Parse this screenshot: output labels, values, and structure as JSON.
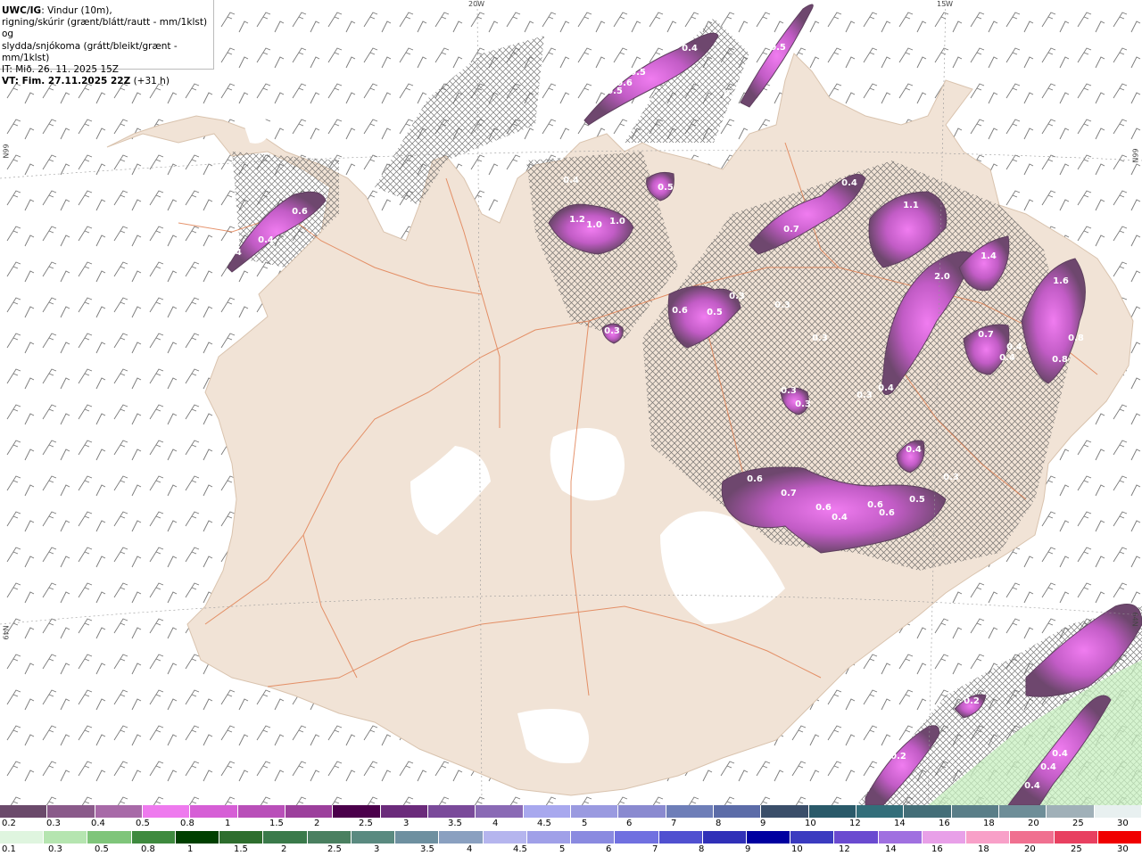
{
  "info": {
    "line1_bold": "UWC/IG",
    "line1_rest": ": Vindur (10m),",
    "line2": "rigning/skúrir (grænt/blátt/rautt - mm/1klst) og",
    "line3": "slydda/snjókoma (grátt/bleikt/grænt - mm/1klst)",
    "line4": "IT: Mið. 26. 11. 2025 15Z",
    "line5_bold": "VT: Fim. 27.11.2025 22Z",
    "line5_rest": " (+31 h)"
  },
  "grid_labels": {
    "lon_20w": "20W",
    "lon_15w": "15W",
    "lat_66n_left": "66N",
    "lat_66n_right": "66N",
    "lat_64n_left": "N49",
    "lat_64n_right": "64N"
  },
  "precip_labels": [
    {
      "id": "a1",
      "text": "0.4"
    },
    {
      "id": "a2",
      "text": "0.5"
    },
    {
      "id": "a3",
      "text": "0.5"
    },
    {
      "id": "a4",
      "text": "0.6"
    },
    {
      "id": "a5",
      "text": "0.5"
    },
    {
      "id": "a6",
      "text": "0.4"
    },
    {
      "id": "a7",
      "text": "0.5"
    },
    {
      "id": "a8",
      "text": "0.3"
    },
    {
      "id": "a9",
      "text": "0.6"
    },
    {
      "id": "a10",
      "text": "0.4"
    },
    {
      "id": "a11",
      "text": "0.4"
    },
    {
      "id": "a12",
      "text": "1.2"
    },
    {
      "id": "a13",
      "text": "1.0"
    },
    {
      "id": "a14",
      "text": "1.0"
    },
    {
      "id": "a15",
      "text": "0.5"
    },
    {
      "id": "a16",
      "text": "0.4"
    },
    {
      "id": "a17",
      "text": "1.1"
    },
    {
      "id": "a18",
      "text": "0.7"
    },
    {
      "id": "a19",
      "text": "1.4"
    },
    {
      "id": "a20",
      "text": "2.0"
    },
    {
      "id": "a21",
      "text": "1.6"
    },
    {
      "id": "a22",
      "text": "0.6"
    },
    {
      "id": "a23",
      "text": "0.5"
    },
    {
      "id": "a24",
      "text": "0.3"
    },
    {
      "id": "a25",
      "text": "0.3"
    },
    {
      "id": "a26",
      "text": "0.3"
    },
    {
      "id": "a27",
      "text": "0.7"
    },
    {
      "id": "a28",
      "text": "0.4"
    },
    {
      "id": "a29",
      "text": "0.8"
    },
    {
      "id": "a30",
      "text": "0.8"
    },
    {
      "id": "a31",
      "text": "0.4"
    },
    {
      "id": "a32",
      "text": "0.3"
    },
    {
      "id": "a33",
      "text": "0.3"
    },
    {
      "id": "a34",
      "text": "0.3"
    },
    {
      "id": "a35",
      "text": "0.4"
    },
    {
      "id": "a36",
      "text": "0.3"
    },
    {
      "id": "a37",
      "text": "0.4"
    },
    {
      "id": "a38",
      "text": "0.6"
    },
    {
      "id": "a39",
      "text": "0.7"
    },
    {
      "id": "a40",
      "text": "0.6"
    },
    {
      "id": "a41",
      "text": "0.4"
    },
    {
      "id": "a42",
      "text": "0.6"
    },
    {
      "id": "a43",
      "text": "0.6"
    },
    {
      "id": "a44",
      "text": "0.5"
    },
    {
      "id": "a45",
      "text": "0.3"
    },
    {
      "id": "a46",
      "text": "0.2"
    },
    {
      "id": "a47",
      "text": "0.2"
    },
    {
      "id": "a48",
      "text": "0.4"
    },
    {
      "id": "a49",
      "text": "0.4"
    },
    {
      "id": "a50",
      "text": "0.4"
    }
  ],
  "legend": {
    "snow_colors": [
      "#6b4a6b",
      "#8a5a8a",
      "#a86aa8",
      "#ee7aee",
      "#d65fd6",
      "#b94fb9",
      "#9c3f9c",
      "#4b004b",
      "#6b2b7b",
      "#7a4a9a",
      "#8a6ab5",
      "#a8a8ee",
      "#9a9ae0",
      "#8a8ad0",
      "#6e7eb8",
      "#5c6ca8",
      "#3a4e6a",
      "#2a5a6a",
      "#336e7a",
      "#446e78",
      "#5a7e88",
      "#6e8e98",
      "#a0b0b8",
      "#e8f0f0"
    ],
    "snow_labels": [
      "0.2",
      "0.3",
      "0.4",
      "0.5",
      "0.8",
      "1",
      "1.5",
      "2",
      "2.5",
      "3",
      "3.5",
      "4",
      "4.5",
      "5",
      "6",
      "7",
      "8",
      "9",
      "10",
      "12",
      "14",
      "16",
      "18",
      "20",
      "25",
      "30"
    ],
    "rain_colors": [
      "#dff5df",
      "#b5e5b0",
      "#7fc57a",
      "#3e8a3e",
      "#004000",
      "#2e6e2e",
      "#3a7a4a",
      "#4a8060",
      "#5a8a80",
      "#6e90a0",
      "#8aa0c0",
      "#b5b5ee",
      "#a0a0e8",
      "#8a8ae0",
      "#7070e0",
      "#5050d0",
      "#3030b8",
      "#0000a0",
      "#3b3bc0",
      "#6a4ad0",
      "#a070e0",
      "#e8a0e8",
      "#f8a0c8",
      "#f07090",
      "#e84060",
      "#f00000"
    ],
    "rain_labels": [
      "0.1",
      "0.3",
      "0.5",
      "0.8",
      "1",
      "1.5",
      "2",
      "2.5",
      "3",
      "3.5",
      "4",
      "4.5",
      "5",
      "6",
      "7",
      "8",
      "9",
      "10",
      "12",
      "14",
      "16",
      "18",
      "20",
      "25",
      "30"
    ]
  }
}
